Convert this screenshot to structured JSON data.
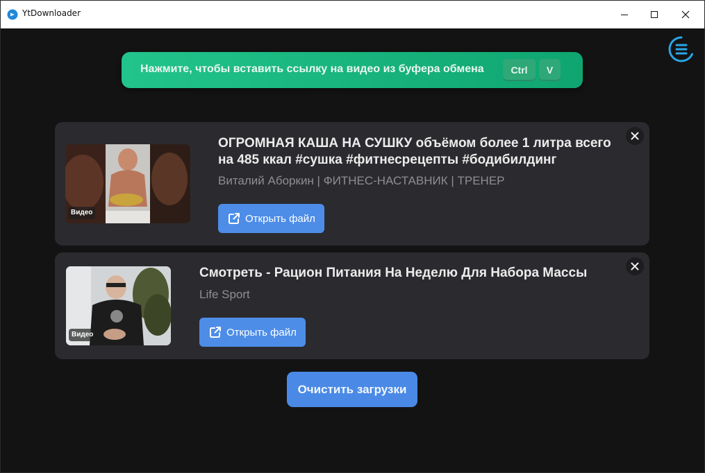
{
  "window": {
    "title": "YtDownloader",
    "icon": "app-logo-icon"
  },
  "paste": {
    "label": "Нажмите, чтобы вставить ссылку на видео из буфера обмена",
    "keys": [
      "Ctrl",
      "V"
    ]
  },
  "downloads": [
    {
      "title": "ОГРОМНАЯ КАША НА СУШКУ объёмом более 1 литра всего на 485 ккал #сушка #фитнесрецепты #бодибилдинг",
      "author": "Виталий Аборкин | ФИТНЕС-НАСТАВНИК | ТРЕНЕР",
      "badge": "Видео",
      "open_label": "Открыть файл"
    },
    {
      "title": "Смотреть - Рацион Питания На Неделю Для Набора Массы",
      "author": "Life Sport",
      "badge": "Видео",
      "open_label": "Открыть файл"
    }
  ],
  "clear_label": "Очистить загрузки",
  "colors": {
    "accent_green": "#16b47f",
    "accent_blue": "#4d8de8",
    "card_bg": "#2b2b2f",
    "menu_icon": "#2aa6e8"
  }
}
